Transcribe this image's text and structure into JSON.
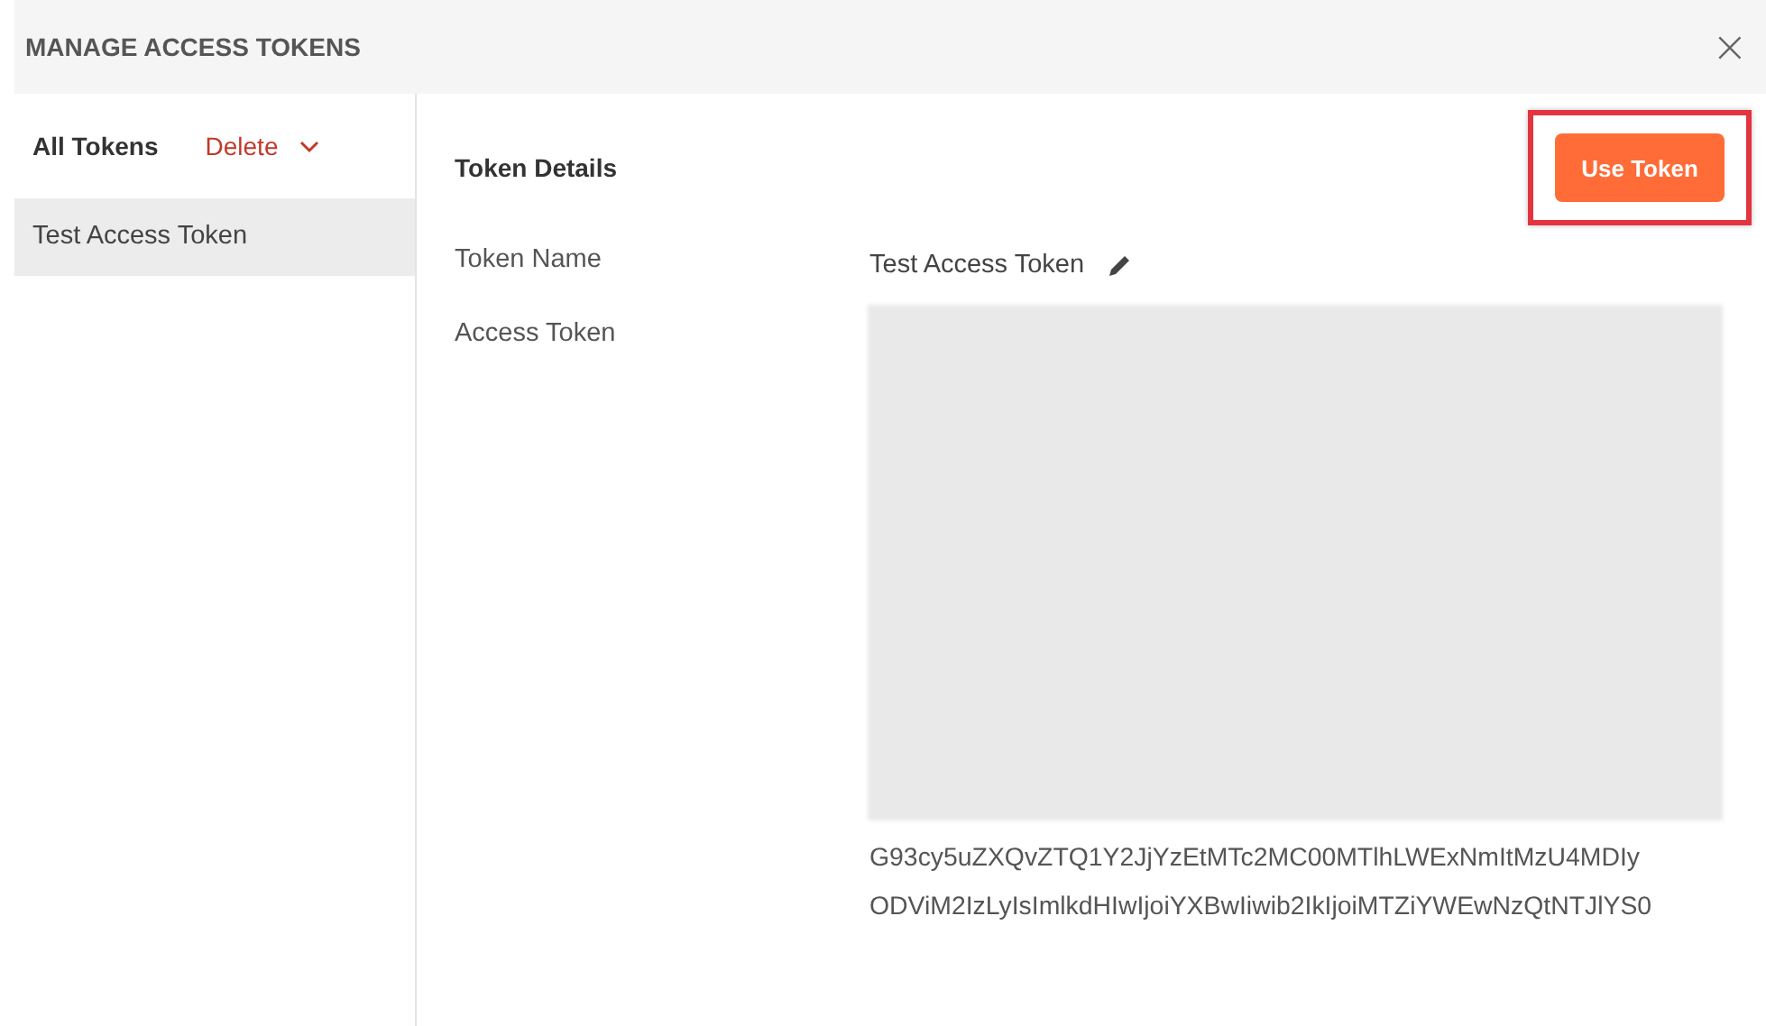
{
  "window": {
    "title": "MANAGE ACCESS TOKENS",
    "close": "×"
  },
  "sidebar": {
    "heading": "All Tokens",
    "delete_label": "Delete",
    "items": [
      {
        "label": "Test Access Token",
        "selected": true
      }
    ]
  },
  "details": {
    "heading": "Token Details",
    "use_button": "Use Token",
    "use_button_highlighted": true,
    "fields": [
      {
        "label": "Token Name",
        "kind": "editable",
        "value": "Test Access Token"
      },
      {
        "label": "Access Token",
        "kind": "token",
        "redacted": true,
        "lines": [
          "G93cy5uZXQvZTQ1Y2JjYzEtMTc2MC00MTlhLWExNmItMzU4MDIy",
          "ODViM2IzLyIsImlkdHIwIjoiYXBwIiwib2IkIjoiMTZiYWEwNzQtNTJlYS0"
        ]
      }
    ]
  }
}
